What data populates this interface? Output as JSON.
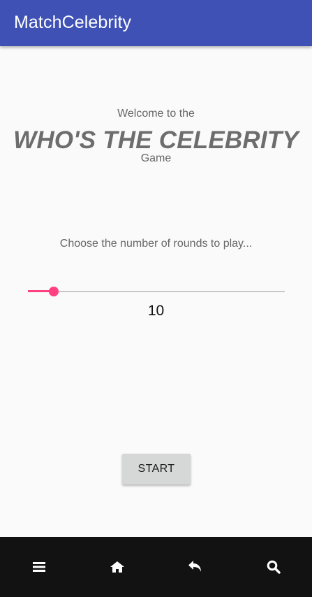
{
  "app_bar": {
    "title": "MatchCelebrity",
    "color": "#3f51b5"
  },
  "intro": {
    "welcome": "Welcome to the",
    "title": "WHO'S THE CELEBRITY",
    "subtitle": "Game"
  },
  "rounds": {
    "prompt": "Choose the number of rounds to play...",
    "value": "10",
    "slider_fraction": 0.1,
    "accent_color": "#ff4081"
  },
  "start_button": {
    "label": "START"
  },
  "nav_bar": {
    "items": [
      {
        "icon": "menu-icon"
      },
      {
        "icon": "home-icon"
      },
      {
        "icon": "back-icon"
      },
      {
        "icon": "search-icon"
      }
    ]
  }
}
